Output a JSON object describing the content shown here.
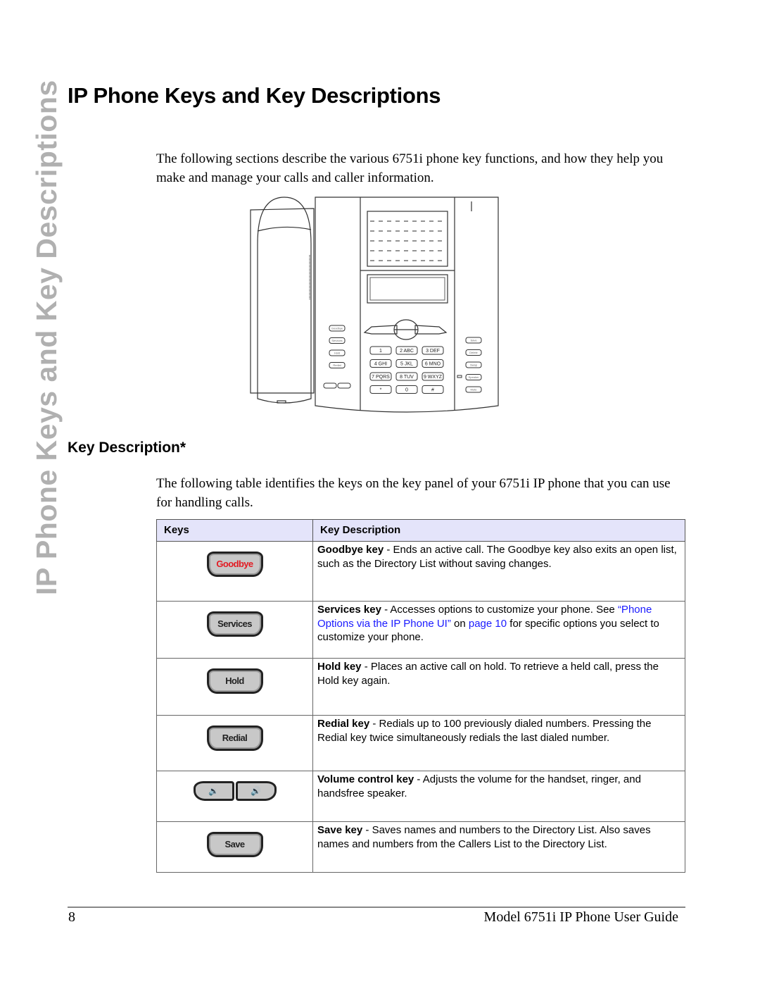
{
  "side_tab": "IP Phone Keys and Key Descriptions",
  "page_title": "IP Phone Keys and Key Descriptions",
  "intro": "The following sections describe the various 6751i phone key functions, and how they help you make and manage your calls and caller information.",
  "phone_illustration": {
    "left_keys": [
      "Goodbye",
      "Services",
      "Hold",
      "Redial"
    ],
    "right_keys": [
      "Save",
      "Delete",
      "Swap",
      "Speaker",
      "Mute"
    ],
    "dialpad": [
      [
        "1",
        ""
      ],
      [
        "2",
        "ABC"
      ],
      [
        "3",
        "DEF"
      ],
      [
        "4",
        "GHI"
      ],
      [
        "5",
        "JKL"
      ],
      [
        "6",
        "MNO"
      ],
      [
        "7",
        "PQRS"
      ],
      [
        "8",
        "TUV"
      ],
      [
        "9",
        "WXYZ"
      ],
      [
        "*",
        ""
      ],
      [
        "0",
        ""
      ],
      [
        "#",
        ""
      ]
    ]
  },
  "section_title": "Key Description*",
  "section_intro": "The following table identifies the keys on the key panel of your 6751i IP phone that you can use for handling calls.",
  "table": {
    "headers": [
      "Keys",
      "Key Description"
    ],
    "rows": [
      {
        "key_label": "Goodbye",
        "key_icon": "goodbye-key-icon",
        "title": "Goodbye key",
        "text": " - Ends an active call. The Goodbye key also exits an open list, such as the Directory List without saving changes."
      },
      {
        "key_label": "Services",
        "key_icon": "services-key-icon",
        "title": "Services key",
        "text_before": " - Accesses options to customize your phone. See ",
        "link1": "“Phone Options via the IP Phone UI”",
        "mid": " on ",
        "link2": "page 10",
        "text_after": " for specific options you select to customize your phone."
      },
      {
        "key_label": "Hold",
        "key_icon": "hold-key-icon",
        "title": "Hold key",
        "text": " - Places an active call on hold. To retrieve a held call, press the Hold key again."
      },
      {
        "key_label": "Redial",
        "key_icon": "redial-key-icon",
        "title": "Redial key",
        "text": " - Redials up to 100 previously dialed numbers. Pressing the Redial key twice simultaneously redials the last dialed number."
      },
      {
        "key_label": "",
        "key_icon": "volume-key-icon",
        "vol_down": "🔉",
        "vol_up": "🔊",
        "title": "Volume control key",
        "text": " - Adjusts the volume for the handset, ringer, and handsfree speaker."
      },
      {
        "key_label": "Save",
        "key_icon": "save-key-icon",
        "title": "Save key",
        "text": " - Saves names and numbers to the Directory List. Also saves names and numbers from the Callers List to the Directory List."
      }
    ]
  },
  "footer": {
    "page_number": "8",
    "guide_title": "Model 6751i IP Phone User Guide"
  },
  "colors": {
    "table_header_bg": "#e4e4fa",
    "link": "#1a1aff",
    "goodbye_red": "#e21b23",
    "side_tab": "#b0b0b0"
  }
}
